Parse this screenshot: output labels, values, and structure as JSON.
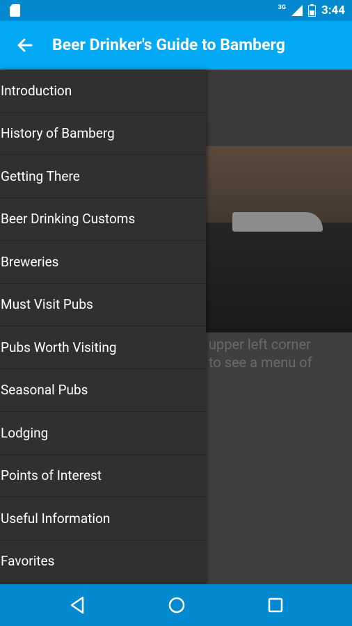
{
  "status": {
    "time": "3:44",
    "network": "3G"
  },
  "app_bar": {
    "title": "Beer Drinker's Guide to Bamberg"
  },
  "background_text": "upper left corner\nto see a menu of",
  "drawer": {
    "items": [
      {
        "label": "Introduction"
      },
      {
        "label": "History of Bamberg"
      },
      {
        "label": "Getting There"
      },
      {
        "label": "Beer Drinking Customs"
      },
      {
        "label": "Breweries"
      },
      {
        "label": "Must Visit Pubs"
      },
      {
        "label": "Pubs Worth Visiting"
      },
      {
        "label": "Seasonal Pubs"
      },
      {
        "label": "Lodging"
      },
      {
        "label": "Points of Interest"
      },
      {
        "label": "Useful Information"
      },
      {
        "label": "Favorites"
      }
    ]
  },
  "colors": {
    "primary": "#03a9f4",
    "primary_dark": "#0289cf",
    "drawer_bg": "#303030"
  }
}
